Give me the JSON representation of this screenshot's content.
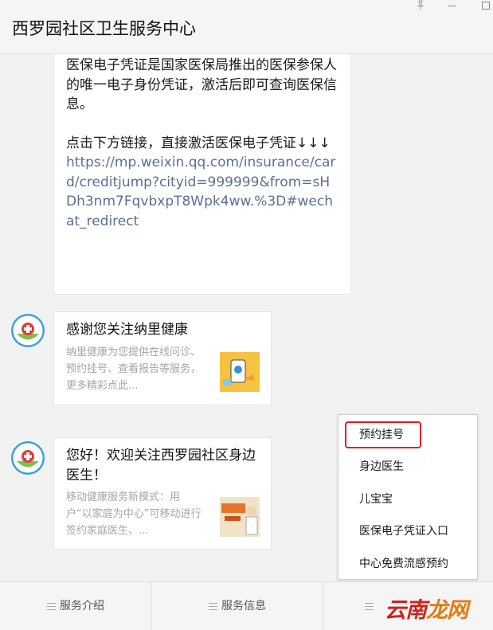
{
  "window": {
    "title": "西罗园社区卫生服务中心"
  },
  "messages": {
    "intro_text": "医保电子凭证是国家医保局推出的医保参保人的唯一电子身份凭证，激活后即可查询医保信息。",
    "cta_text": "点击下方链接，直接激活医保电子凭证↓↓↓",
    "link_url": "https://mp.weixin.qq.com/insurance/card/creditjump?cityid=999999&from=sHDh3nm7FqvbxpT8Wpk4ww.%3D#wechat_redirect"
  },
  "cards": [
    {
      "title": "感谢您关注纳里健康",
      "desc": "纳里健康为您提供在线问诊、预约挂号、查看报告等服务，更多精彩点此..."
    },
    {
      "title": "您好！欢迎关注西罗园社区身边医生！",
      "desc": "移动健康服务新模式：用户“以家庭为中心”可移动进行签约家庭医生、..."
    }
  ],
  "menu": {
    "items": [
      "预约挂号",
      "身边医生",
      "儿宝宝",
      "医保电子凭证入口",
      "中心免费流感预约"
    ]
  },
  "bottom_tabs": [
    "服务介绍",
    "服务信息",
    ""
  ],
  "watermark": {
    "part1": "云南",
    "part2": "龙网"
  },
  "colors": {
    "link": "#5b6f95",
    "highlight_border": "#e02020",
    "watermark_red": "#d2201c"
  },
  "icons": {
    "pin": "pin-icon",
    "minimize": "minimize-icon",
    "maximize": "maximize-icon",
    "avatar": "hospital-cross-logo",
    "menu": "hamburger-icon"
  }
}
